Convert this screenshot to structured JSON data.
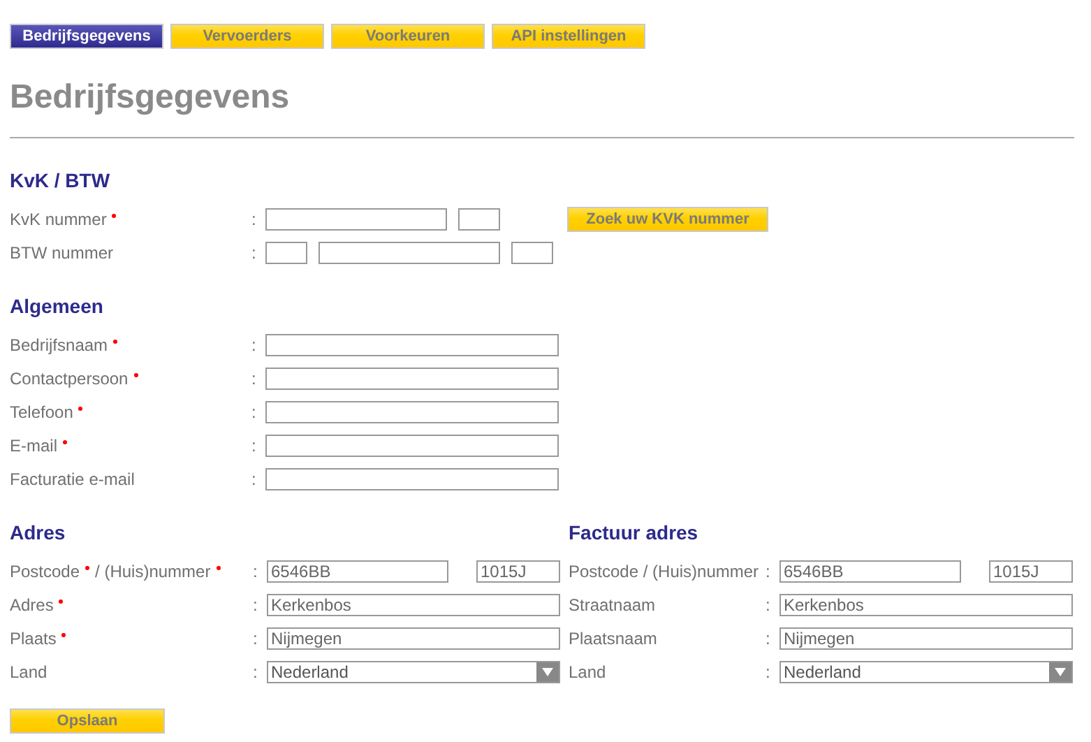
{
  "tabs": [
    {
      "label": "Bedrijfsgegevens",
      "selected": true
    },
    {
      "label": "Vervoerders",
      "selected": false
    },
    {
      "label": "Voorkeuren",
      "selected": false
    },
    {
      "label": "API instellingen",
      "selected": false
    }
  ],
  "title": "Bedrijfsgegevens",
  "sections": [
    {
      "heading": "KvK / BTW",
      "rows": [
        {
          "label_parts": [
            {
              "text": "KvK nummer",
              "required": true
            }
          ],
          "fields": [
            {
              "kind": "medium"
            },
            {
              "kind": "small"
            }
          ],
          "button": "Zoek uw KVK nummer"
        },
        {
          "label_parts": [
            {
              "text": "BTW nummer",
              "required": false
            }
          ],
          "fields": [
            {
              "kind": "small"
            },
            {
              "kind": "medium"
            },
            {
              "kind": "small"
            }
          ]
        }
      ]
    },
    {
      "heading": "Algemeen",
      "rows": [
        {
          "label_parts": [
            {
              "text": "Bedrijfsnaam",
              "required": true
            }
          ],
          "fields": [
            {
              "kind": "full"
            }
          ]
        },
        {
          "label_parts": [
            {
              "text": "Contactpersoon",
              "required": true
            }
          ],
          "fields": [
            {
              "kind": "full"
            }
          ]
        },
        {
          "label_parts": [
            {
              "text": "Telefoon",
              "required": true
            }
          ],
          "fields": [
            {
              "kind": "full"
            }
          ]
        },
        {
          "label_parts": [
            {
              "text": "E-mail",
              "required": true
            }
          ],
          "fields": [
            {
              "kind": "full"
            }
          ]
        },
        {
          "label_parts": [
            {
              "text": "Facturatie e-mail",
              "required": false
            }
          ],
          "fields": [
            {
              "kind": "full"
            }
          ]
        }
      ]
    }
  ],
  "address_columns": [
    {
      "heading": "Adres",
      "rows": [
        {
          "label_parts": [
            {
              "text": "Postcode",
              "required": true
            },
            {
              "text": "/ (Huis)nummer",
              "required": true
            }
          ],
          "fields": [
            {
              "kind": "medium",
              "value": "6546BB"
            },
            {
              "kind": "number",
              "value": "1015J"
            }
          ]
        },
        {
          "label_parts": [
            {
              "text": "Adres",
              "required": true
            }
          ],
          "fields": [
            {
              "kind": "full",
              "value": "Kerkenbos"
            }
          ]
        },
        {
          "label_parts": [
            {
              "text": "Plaats",
              "required": true
            }
          ],
          "fields": [
            {
              "kind": "full",
              "value": "Nijmegen"
            }
          ]
        },
        {
          "label_parts": [
            {
              "text": "Land",
              "required": false
            }
          ],
          "fields": [
            {
              "kind": "select",
              "value": "Nederland"
            }
          ]
        }
      ]
    },
    {
      "heading": "Factuur adres",
      "rows": [
        {
          "label_parts": [
            {
              "text": "Postcode / (Huis)nummer",
              "required": false
            }
          ],
          "fields": [
            {
              "kind": "medium",
              "value": "6546BB"
            },
            {
              "kind": "number",
              "value": "1015J"
            }
          ]
        },
        {
          "label_parts": [
            {
              "text": "Straatnaam",
              "required": false
            }
          ],
          "fields": [
            {
              "kind": "full",
              "value": "Kerkenbos"
            }
          ]
        },
        {
          "label_parts": [
            {
              "text": "Plaatsnaam",
              "required": false
            }
          ],
          "fields": [
            {
              "kind": "full",
              "value": "Nijmegen"
            }
          ]
        },
        {
          "label_parts": [
            {
              "text": "Land",
              "required": false
            }
          ],
          "fields": [
            {
              "kind": "select",
              "value": "Nederland"
            }
          ]
        }
      ]
    }
  ],
  "colon": ":",
  "save_button": "Opslaan"
}
